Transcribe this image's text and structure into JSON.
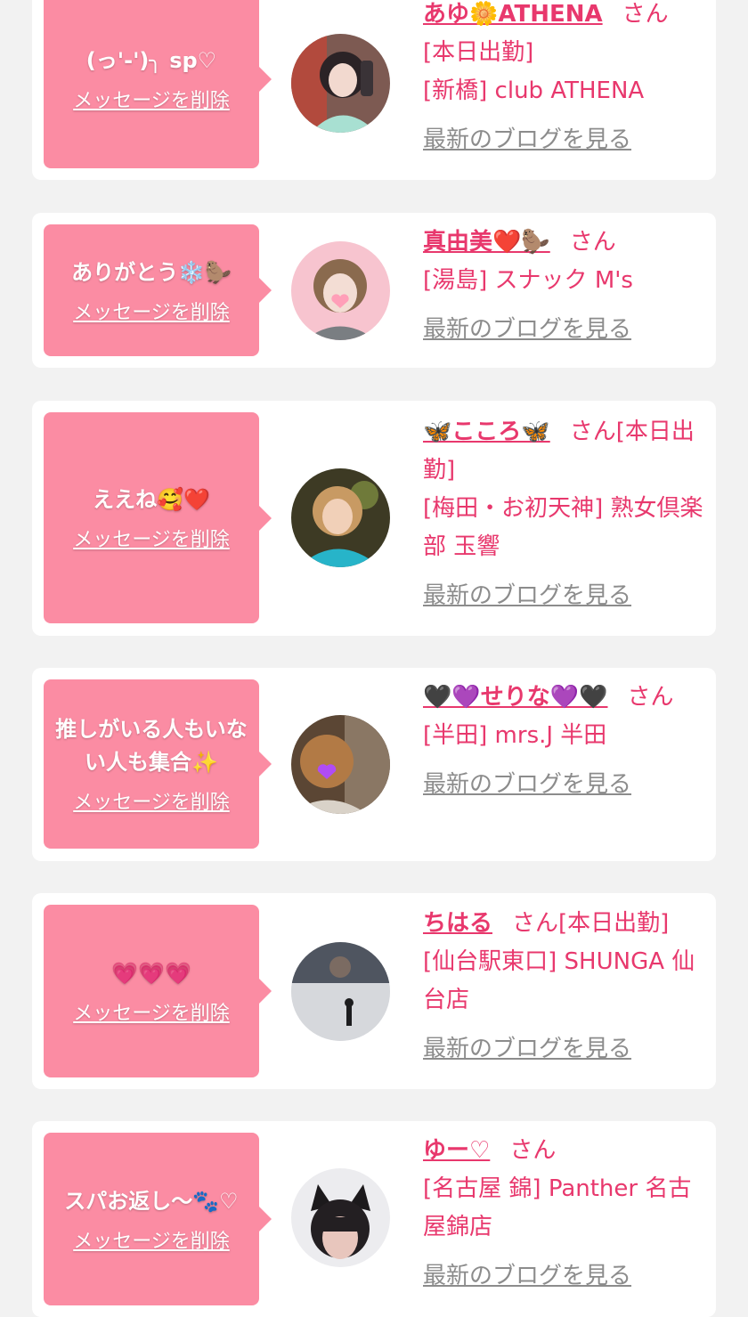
{
  "common": {
    "delete_label": "メッセージを削除",
    "blog_label": "最新のブログを見る",
    "san": "さん",
    "accent_color": "#e8386d",
    "bubble_color": "#fb8ca3",
    "link_gray": "#8c8c8c"
  },
  "messages": [
    {
      "message": "(っ'-')╮ sp♡",
      "cast_name": "あゆ🌼ATHENA",
      "lines": [
        "[本日出勤]",
        "[新橋] club ATHENA"
      ]
    },
    {
      "message": "ありがとう❄️🦫",
      "cast_name": "真由美❤️🦫",
      "lines": [
        "[湯島] スナック M's"
      ]
    },
    {
      "message": "ええね🥰❤️",
      "cast_name": "🦋こころ🦋",
      "name_suffix": "[本日出勤]",
      "lines": [
        "[梅田・お初天神] 熟女倶楽部 玉響"
      ]
    },
    {
      "message": "推しがいる人もいない人も集合✨",
      "cast_name": "🖤💜せりな💜🖤",
      "lines": [
        "[半田] mrs.J 半田"
      ]
    },
    {
      "message": "💗💗💗",
      "cast_name": "ちはる",
      "name_suffix": "[本日出勤]",
      "lines": [
        "[仙台駅東口] SHUNGA 仙台店"
      ]
    },
    {
      "message": "スパお返し〜🐾♡",
      "cast_name": "ゆー♡",
      "lines": [
        "[名古屋 錦] Panther 名古屋錦店"
      ]
    }
  ]
}
